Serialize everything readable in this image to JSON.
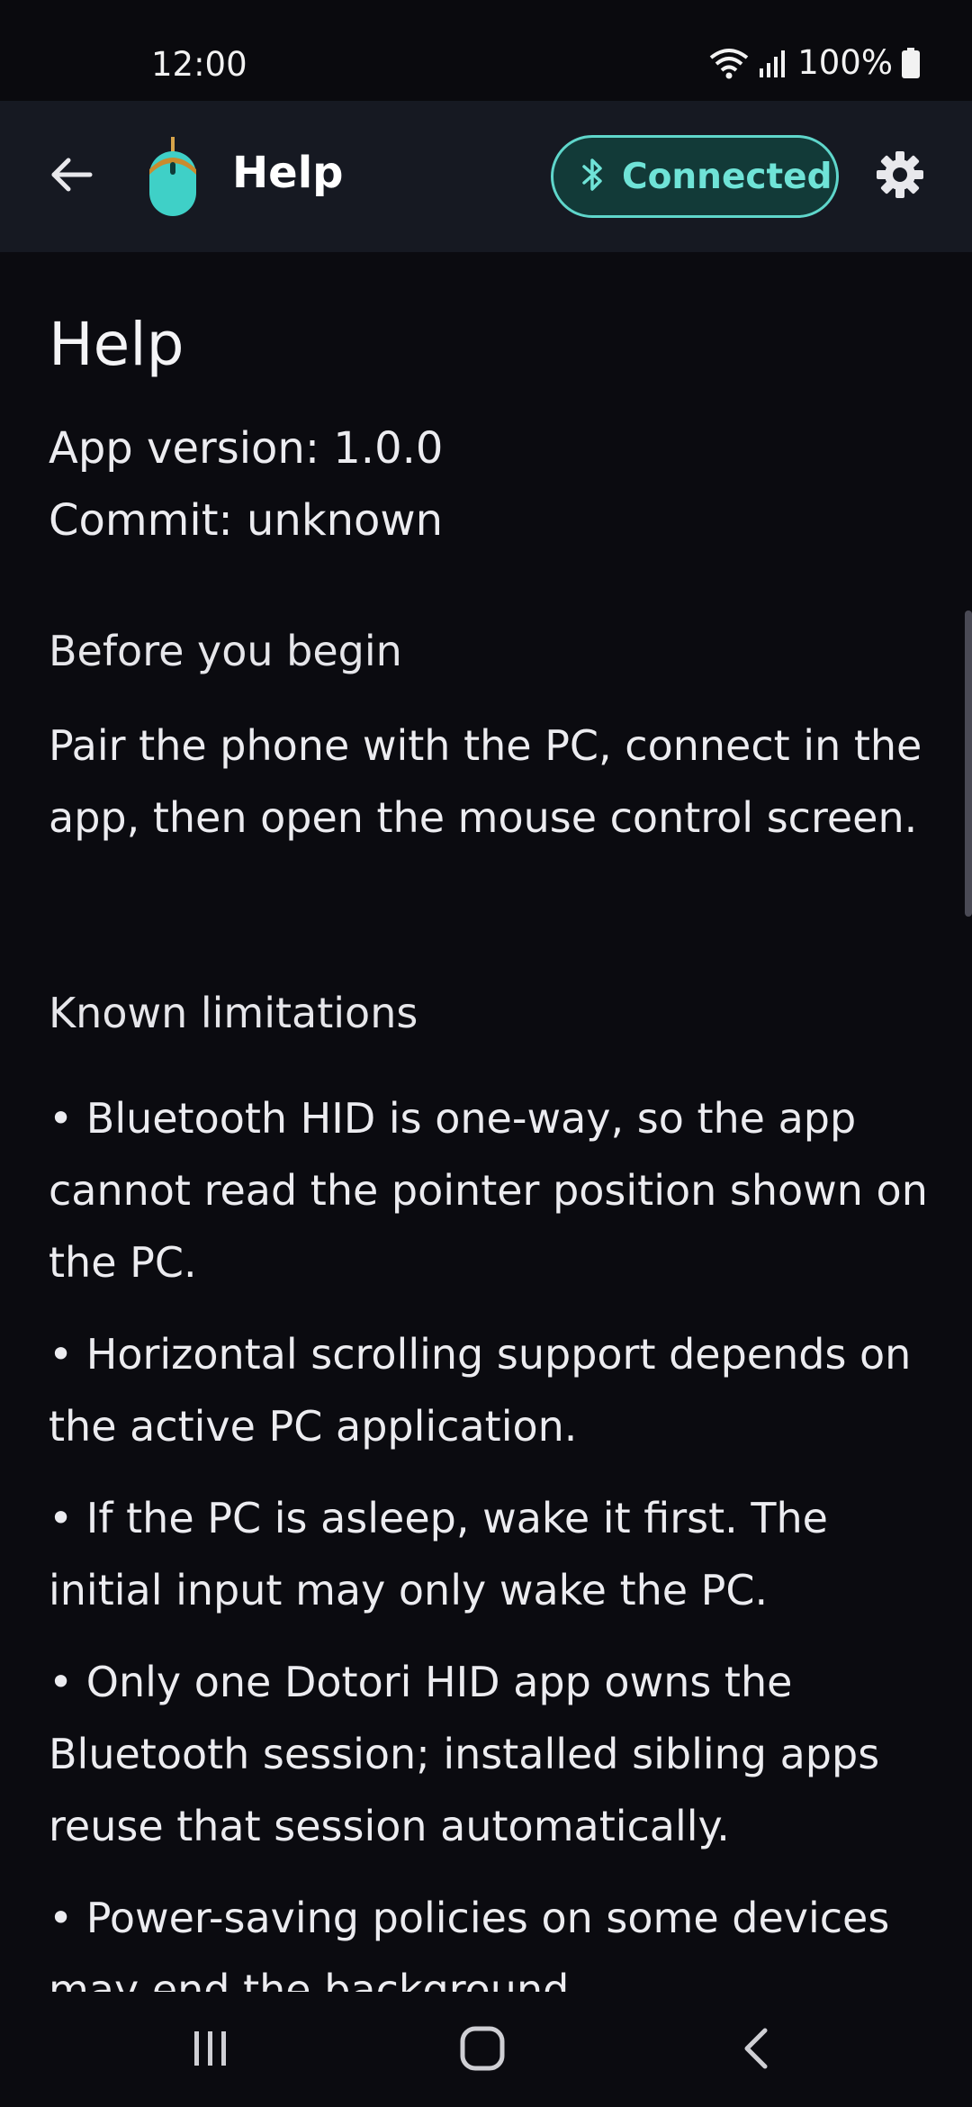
{
  "status_bar": {
    "time": "12:00",
    "battery": "100%"
  },
  "app_bar": {
    "title": "Help",
    "connection_status": "Connected",
    "icons": {
      "back": "arrow-left-icon",
      "logo": "mouse-logo-icon",
      "bluetooth": "bluetooth-icon",
      "settings": "gear-icon"
    },
    "colors": {
      "accent": "#5fd6cb",
      "chip_background": "#123a38",
      "bar_background": "#161922"
    }
  },
  "content": {
    "heading": "Help",
    "app_version": "App version: 1.0.0",
    "commit": "Commit: unknown",
    "sections": [
      {
        "title": "Before you begin",
        "paragraphs": [
          "Pair the phone with the PC, connect in the app, then open the mouse control screen."
        ]
      },
      {
        "title": "Known limitations",
        "paragraphs": [
          "• Bluetooth HID is one-way, so the app cannot read the pointer position shown on the PC.",
          "• Horizontal scrolling support depends on the active PC application.",
          "• If the PC is asleep, wake it first. The initial input may only wake the PC.",
          "• Only one Dotori HID app owns the Bluetooth session; installed sibling apps reuse that session automatically.",
          "• Power-saving policies on some devices may end the background"
        ]
      }
    ]
  },
  "nav_bar": {
    "icons": [
      "recents-icon",
      "home-icon",
      "back-icon"
    ]
  }
}
